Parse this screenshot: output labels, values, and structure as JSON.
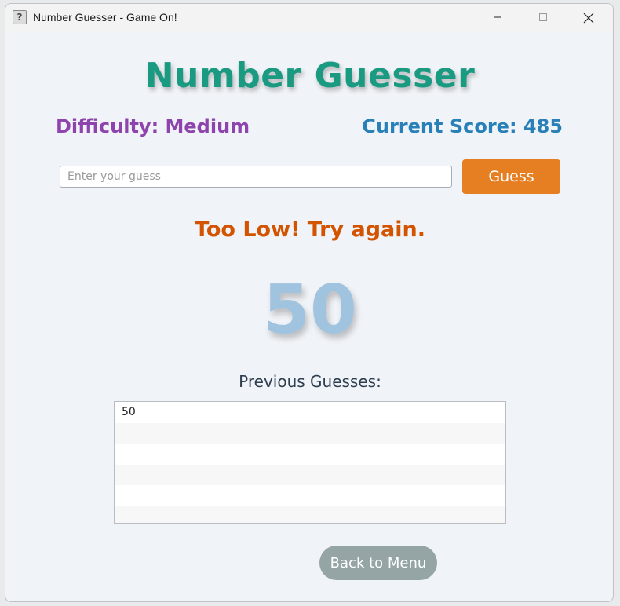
{
  "window": {
    "title": "Number Guesser - Game On!",
    "icon": "question-mark-icon",
    "controls": [
      "minimize-icon",
      "maximize-icon",
      "close-icon"
    ]
  },
  "header": {
    "title": "Number Guesser"
  },
  "status": {
    "difficulty": "Difficulty: Medium",
    "score": "Current Score: 485"
  },
  "guess": {
    "input_value": "",
    "placeholder": "Enter your guess",
    "button_label": "Guess"
  },
  "feedback": {
    "message": "Too Low! Try again."
  },
  "last_guess": "50",
  "history": {
    "label": "Previous Guesses:",
    "items": [
      "50",
      "",
      "",
      "",
      "",
      ""
    ]
  },
  "footer": {
    "back_label": "Back to Menu"
  },
  "colors": {
    "title": "#1a9a80",
    "difficulty": "#8e44ad",
    "score": "#2980b9",
    "guess_button": "#e67e22",
    "feedback": "#d35400",
    "big_number": "#a0c4df",
    "back_button": "#95a5a6"
  }
}
